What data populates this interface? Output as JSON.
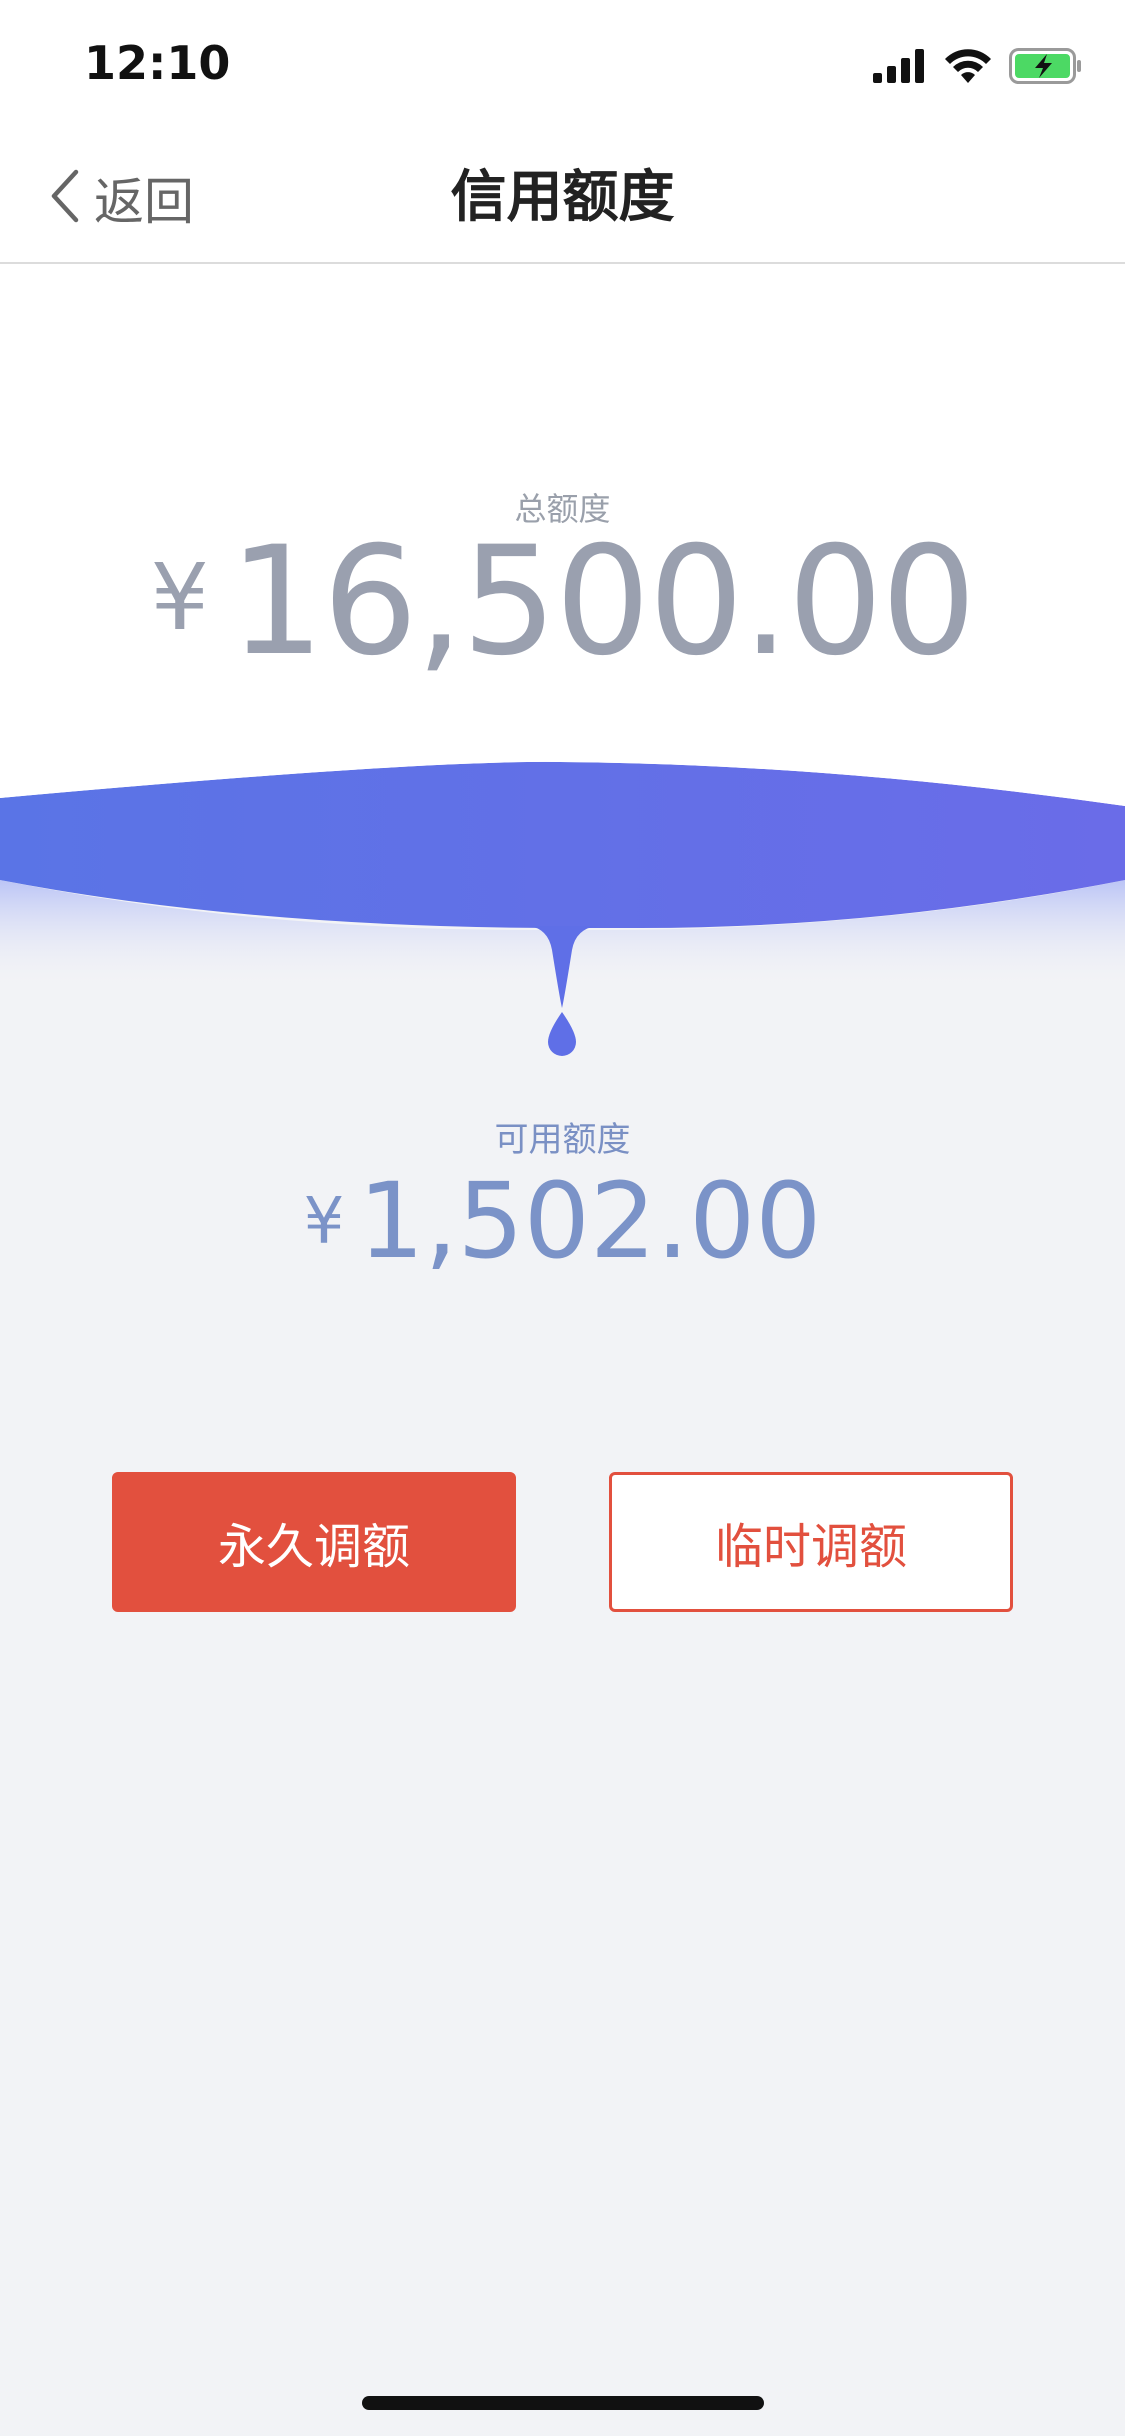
{
  "status_bar": {
    "time": "12:10",
    "icons": [
      "cellular-signal-icon",
      "wifi-icon",
      "battery-charging-icon"
    ]
  },
  "nav": {
    "back_label": "返回",
    "back_icon": "chevron-left-icon",
    "title": "信用额度"
  },
  "total_credit": {
    "label": "总额度",
    "currency": "¥",
    "amount": "16,500.00"
  },
  "available_credit": {
    "label": "可用额度",
    "currency": "¥",
    "amount": "1,502.00"
  },
  "actions": {
    "permanent_label": "永久调额",
    "temporary_label": "临时调额"
  },
  "colors": {
    "accent_red": "#e2503e",
    "wave_start": "#5a74e6",
    "wave_end": "#6a6ce8",
    "background": "#f2f3f6"
  }
}
